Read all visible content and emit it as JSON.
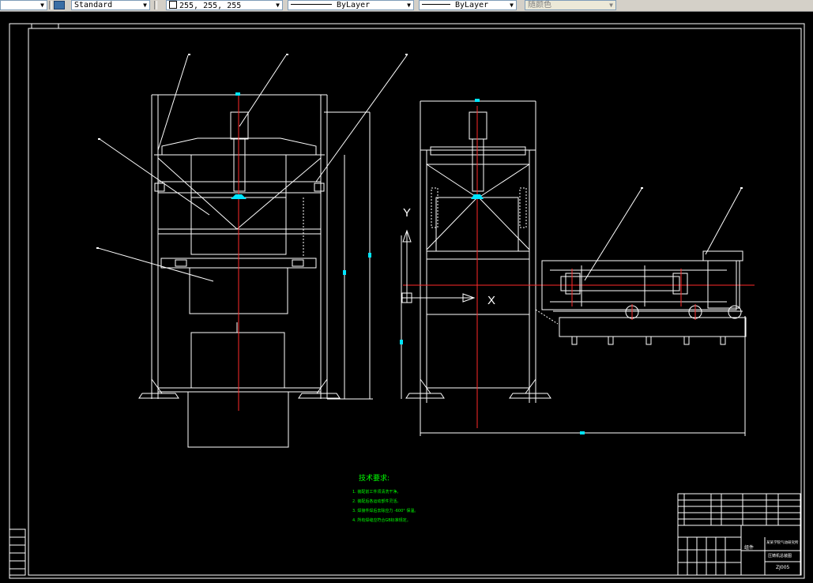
{
  "toolbar": {
    "text_style": "Standard",
    "color_value": "255, 255, 255",
    "linetype": "ByLayer",
    "lineweight": "ByLayer",
    "plot_style": "随颜色"
  },
  "drawing": {
    "axis_y_label": "Y",
    "axis_x_label": "X",
    "tech_notes_title": "技术要求:",
    "tech_notes": [
      "1. 装配前工件须清洗干净。",
      "2. 装配后各运动部件灵活。",
      "3. 焊接件焊后去除应力 -600° 保温。",
      "4. 所有焊缝应符合GB标准规定。"
    ],
    "title_block": {
      "material": "组件",
      "school": "某某学院气动研究所",
      "drawing_name": "压铸机总装图",
      "drawing_no": "ZJ005"
    }
  },
  "colors": {
    "outline": "#ffffff",
    "centerline": "#ff2a2a",
    "leader": "#ffffff",
    "dimension": "#ffffff",
    "dim_marker": "#00e5ff",
    "note_text": "#00ff00",
    "background": "#000000"
  }
}
